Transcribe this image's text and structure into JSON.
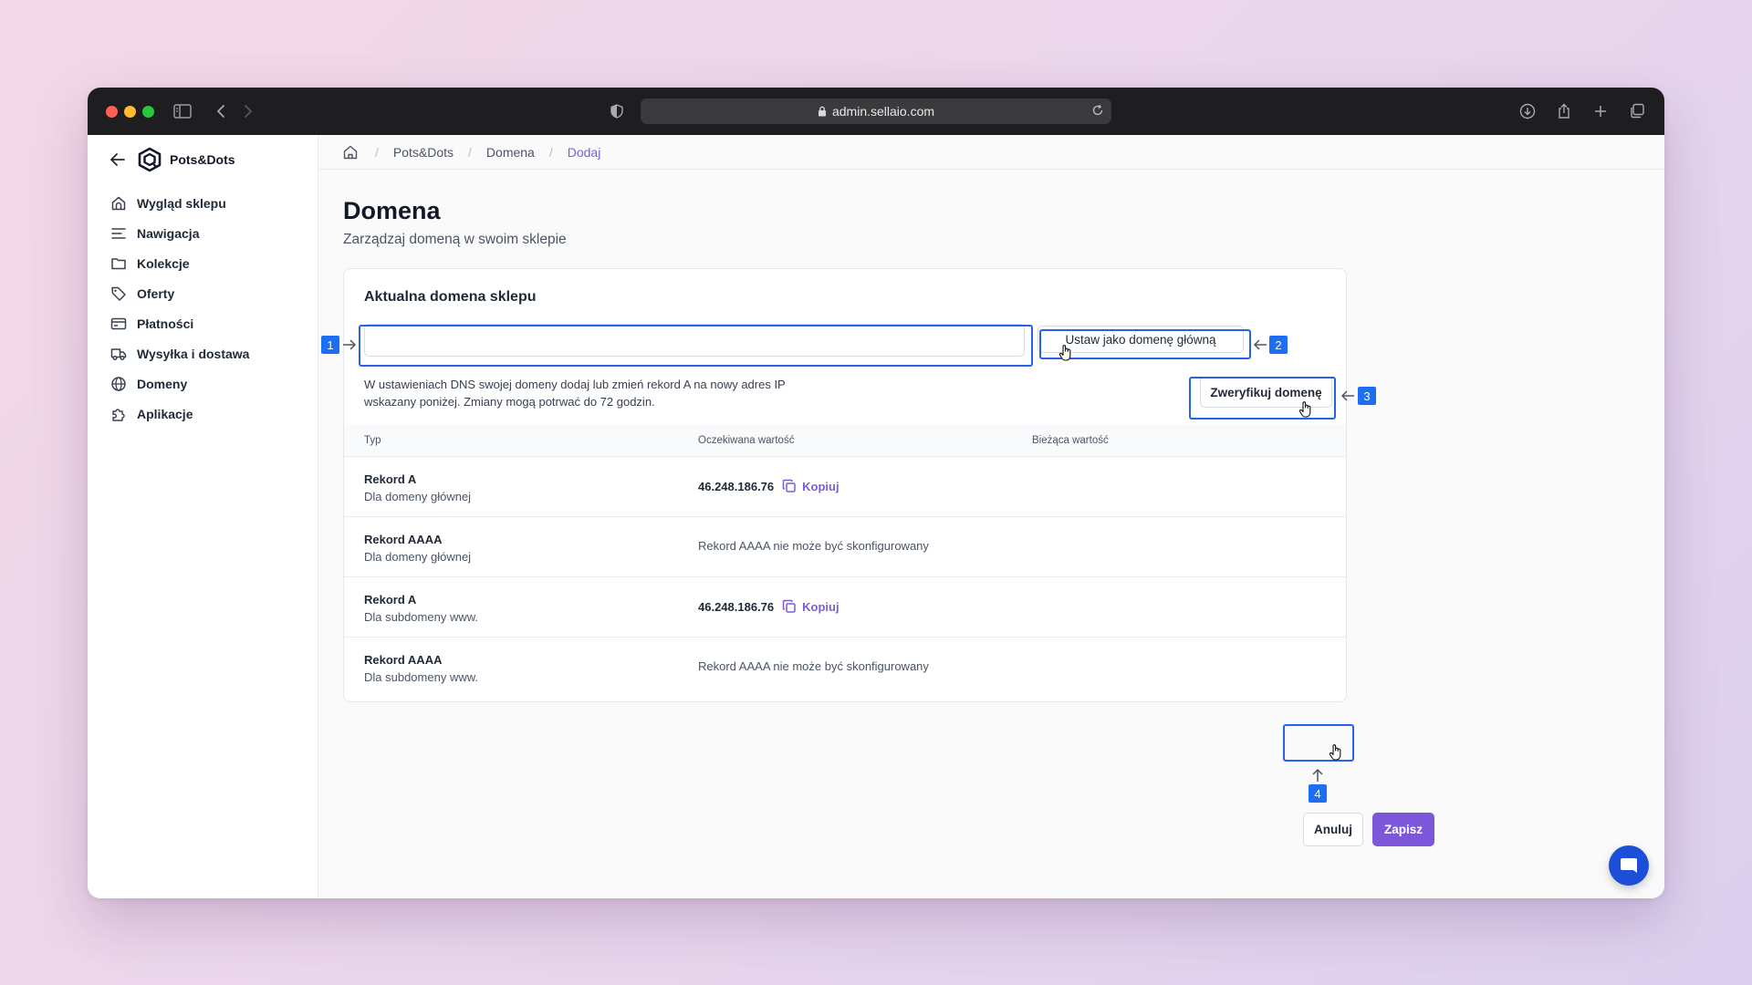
{
  "browser": {
    "url": "admin.sellaio.com"
  },
  "sidebar": {
    "brand": "Pots&Dots",
    "items": [
      {
        "label": "Wygląd sklepu",
        "icon": "home-icon"
      },
      {
        "label": "Nawigacja",
        "icon": "menu-lines-icon"
      },
      {
        "label": "Kolekcje",
        "icon": "folder-icon"
      },
      {
        "label": "Oferty",
        "icon": "tag-icon"
      },
      {
        "label": "Płatności",
        "icon": "credit-card-icon"
      },
      {
        "label": "Wysyłka i dostawa",
        "icon": "truck-icon"
      },
      {
        "label": "Domeny",
        "icon": "globe-icon"
      },
      {
        "label": "Aplikacje",
        "icon": "puzzle-icon"
      }
    ]
  },
  "breadcrumb": {
    "items": [
      "Pots&Dots",
      "Domena",
      "Dodaj"
    ]
  },
  "page": {
    "title": "Domena",
    "subtitle": "Zarządzaj domeną w swoim sklepie"
  },
  "card": {
    "title": "Aktualna domena sklepu",
    "domain_input": {
      "value": "",
      "placeholder": ""
    },
    "set_primary_label": "Ustaw jako domenę główną",
    "verify_label": "Zweryfikuj domenę",
    "help_line1": "W ustawieniach DNS swojej domeny dodaj lub zmień rekord A na nowy adres IP",
    "help_line2": "wskazany poniżej. Zmiany mogą potrwać do 72 godzin."
  },
  "table": {
    "headers": [
      "Typ",
      "Oczekiwana wartość",
      "Bieżąca wartość"
    ],
    "rows": [
      {
        "type": "Rekord A",
        "sub": "Dla domeny głównej",
        "value": "46.248.186.76",
        "copy": "Kopiuj",
        "note": ""
      },
      {
        "type": "Rekord AAAA",
        "sub": "Dla domeny głównej",
        "value": "",
        "copy": "",
        "note": "Rekord AAAA nie może być skonfigurowany"
      },
      {
        "type": "Rekord A",
        "sub": "Dla subdomeny www.",
        "value": "46.248.186.76",
        "copy": "Kopiuj",
        "note": ""
      },
      {
        "type": "Rekord AAAA",
        "sub": "Dla subdomeny www.",
        "value": "",
        "copy": "",
        "note": "Rekord AAAA nie może być skonfigurowany"
      }
    ]
  },
  "actions": {
    "cancel_label": "Anuluj",
    "save_label": "Zapisz"
  },
  "markers": [
    "1",
    "2",
    "3",
    "4"
  ],
  "colors": {
    "accent": "#7c57d9",
    "marker": "#1d6ef0",
    "chat": "#1d4ed8"
  }
}
